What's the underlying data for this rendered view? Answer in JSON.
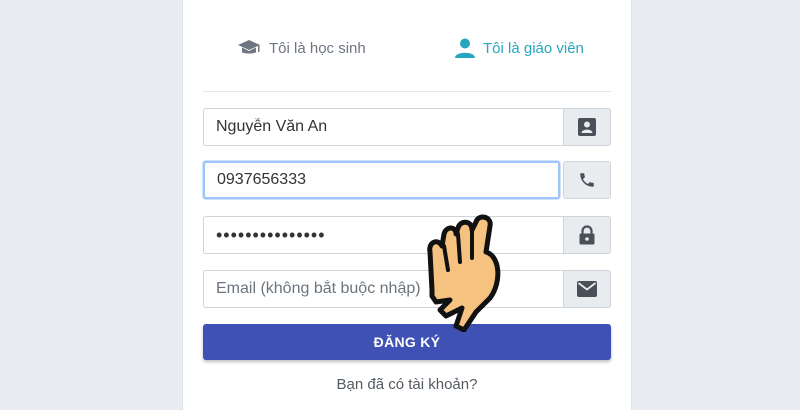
{
  "roles": {
    "student_label": "Tôi là học sinh",
    "student_icon": "graduation-cap-icon",
    "teacher_label": "Tôi là giáo viên",
    "teacher_icon": "user-icon",
    "active": "teacher",
    "active_color": "#26a6bf"
  },
  "form": {
    "name": {
      "value": "Nguyễn Văn An",
      "icon": "contact-card-icon"
    },
    "phone": {
      "value": "0937656333",
      "icon": "phone-icon"
    },
    "password": {
      "value": "•••••••••••••••",
      "icon": "lock-icon"
    },
    "email": {
      "value": "",
      "placeholder": "Email (không bắt buộc nhập)",
      "icon": "envelope-icon"
    }
  },
  "submit_label": "ĐĂNG KÝ",
  "submit_color": "#3f51b5",
  "login_link": "Bạn đã có tài khoản?"
}
